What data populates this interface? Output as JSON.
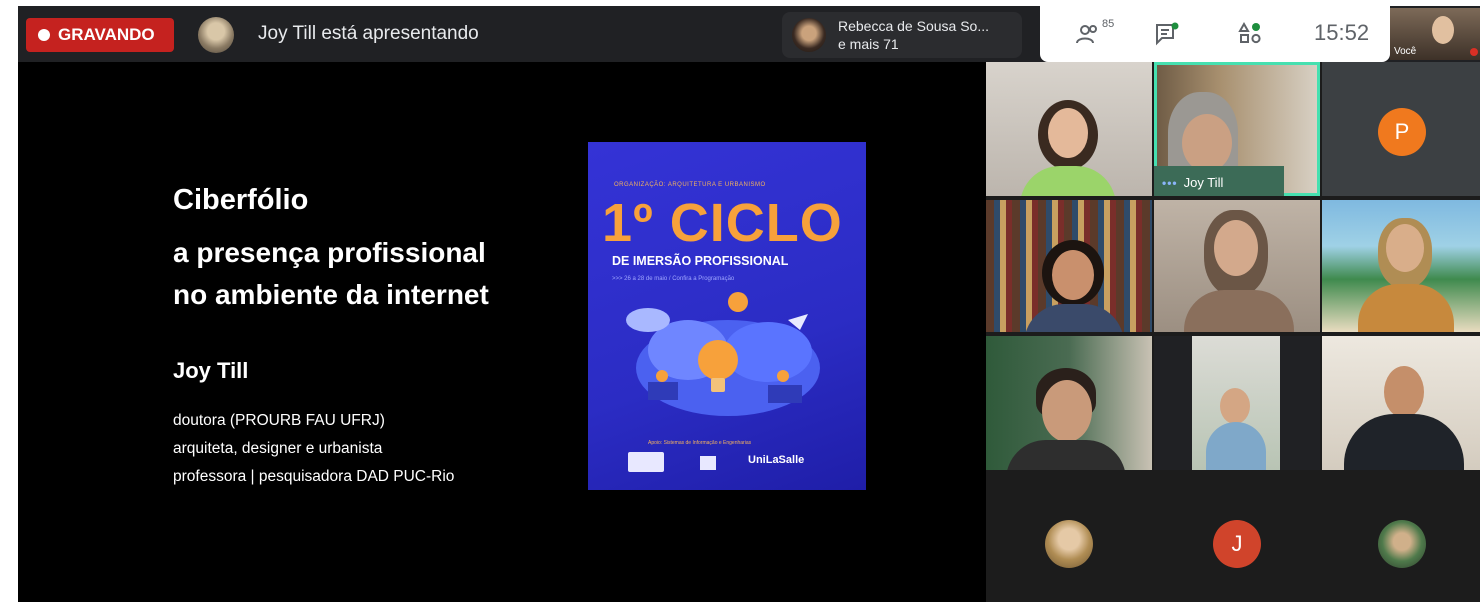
{
  "topbar": {
    "recording_label": "GRAVANDO",
    "presenting_text": "Joy Till está apresentando",
    "other_presenter_line1": "Rebecca de Sousa So...",
    "other_presenter_line2": "e mais 71",
    "participants_count": "85",
    "time": "15:52",
    "self_label": "Você"
  },
  "slide": {
    "title": "Ciberfólio",
    "subtitle_line1": "a presença profissional",
    "subtitle_line2": "no ambiente da internet",
    "speaker": "Joy Till",
    "bio_line1": "doutora (PROURB FAU UFRJ)",
    "bio_line2": "arquiteta, designer e urbanista",
    "bio_line3": "professora | pesquisadora DAD PUC-Rio"
  },
  "poster": {
    "org_line": "ORGANIZAÇÃO: ARQUITETURA E URBANISMO",
    "headline": "1º CICLO",
    "subheadline": "DE IMERSÃO PROFISSIONAL",
    "dates": ">>> 26 a 28 de maio / Confira a Programação",
    "footer": "Apoio: Sistemas de Informação e Engenharias",
    "logo_text": "UniLaSalle"
  },
  "participants": {
    "active_speaker_name": "Joy Till",
    "avatar_letters": [
      "P",
      "J"
    ]
  },
  "colors": {
    "recording": "#c5221f",
    "speaker_outline": "#46e0b0",
    "avatar_p": "#f0791e",
    "avatar_j": "#d0442b",
    "poster_bg": "#2b2cc4",
    "poster_accent": "#f7a13b"
  }
}
